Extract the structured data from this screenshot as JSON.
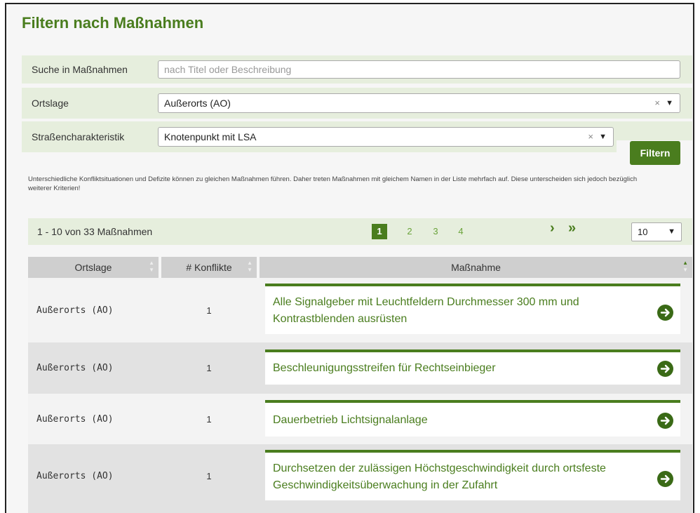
{
  "title": "Filtern nach Maßnahmen",
  "search": {
    "label": "Suche in Maßnahmen",
    "placeholder": "nach Titel oder Beschreibung",
    "value": ""
  },
  "ortslage": {
    "label": "Ortslage",
    "value": "Außerorts (AO)",
    "clear": "×",
    "arrow": "▼"
  },
  "strasse": {
    "label": "Straßencharakteristik",
    "value": "Knotenpunkt mit LSA",
    "clear": "×",
    "arrow": "▼"
  },
  "filter_button": "Filtern",
  "hint": "Unterschiedliche Konfliktsituationen und Defizite können zu gleichen Maßnahmen führen. Daher treten Maßnahmen mit gleichem Namen in der Liste mehrfach auf. Diese unterscheiden sich jedoch bezüglich weiterer Kriterien!",
  "pager": {
    "count_text": "1 - 10 von 33 Maßnahmen",
    "pages": [
      "1",
      "2",
      "3",
      "4"
    ],
    "next": "›",
    "last": "»",
    "per_page": "10",
    "arrow": "▼"
  },
  "table": {
    "headers": {
      "ortslage": "Ortslage",
      "konflikte": "# Konflikte",
      "massnahme": "Maßnahme"
    },
    "rows": [
      {
        "ortslage": "Außerorts (AO)",
        "konflikte": "1",
        "massnahme": "Alle Signalgeber mit Leuchtfeldern Durchmesser 300 mm und Kontrastblenden ausrüsten"
      },
      {
        "ortslage": "Außerorts (AO)",
        "konflikte": "1",
        "massnahme": "Beschleunigungsstreifen für Rechtseinbieger"
      },
      {
        "ortslage": "Außerorts (AO)",
        "konflikte": "1",
        "massnahme": "Dauerbetrieb Lichtsignalanlage"
      },
      {
        "ortslage": "Außerorts (AO)",
        "konflikte": "1",
        "massnahme": "Durchsetzen der zulässigen Höchstgeschwindigkeit durch ortsfeste Geschwindigkeitsüberwachung in der Zufahrt"
      }
    ]
  },
  "colors": {
    "accent": "#4a7d1e",
    "filter_bg": "#e6eedd",
    "header_bg": "#cfcfcf"
  }
}
